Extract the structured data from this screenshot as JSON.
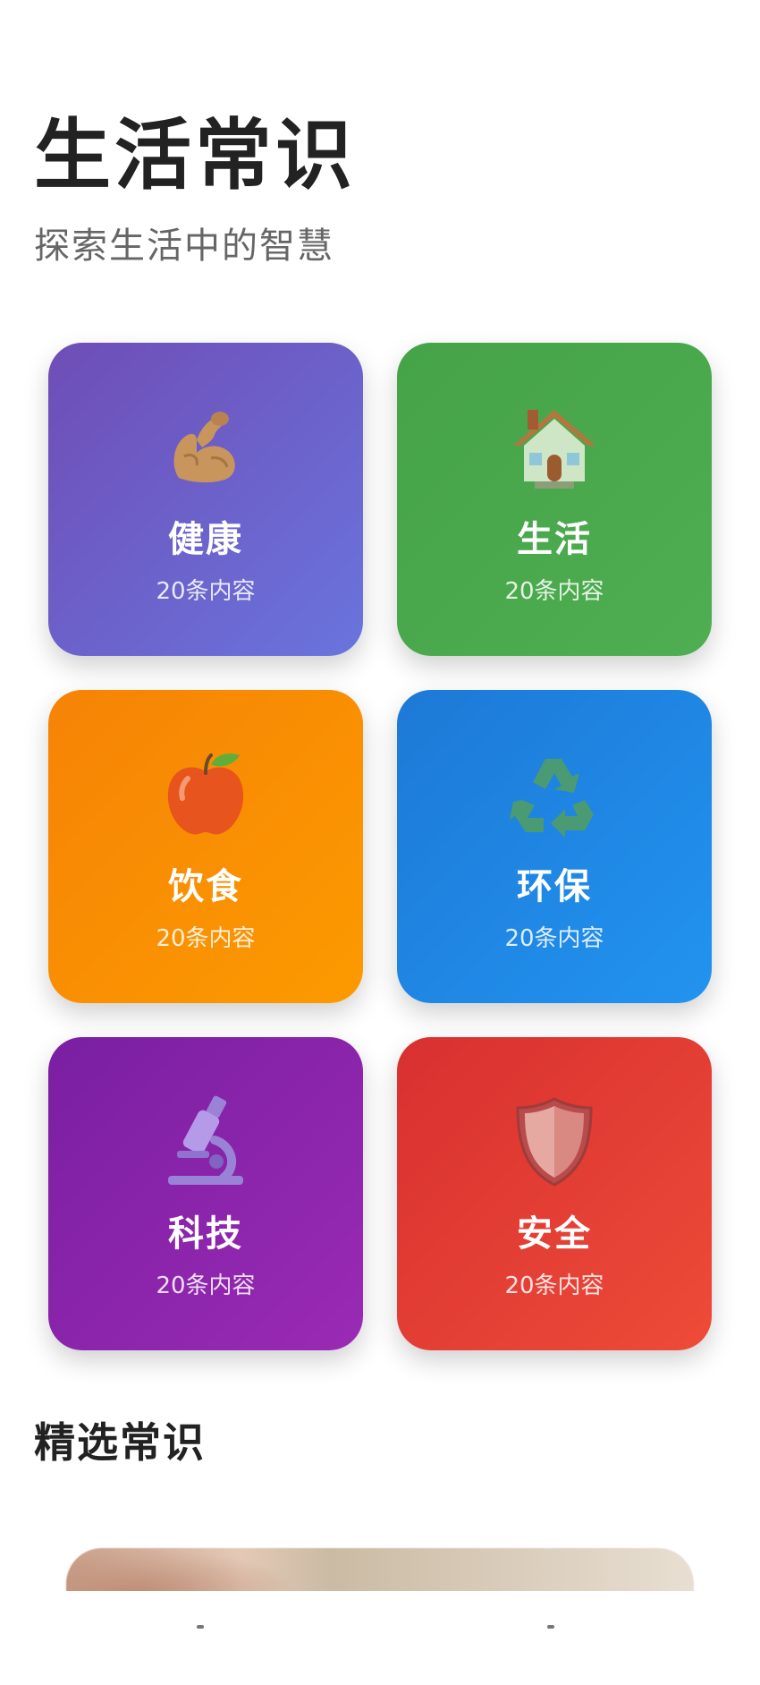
{
  "header": {
    "title": "生活常识",
    "subtitle": "探索生活中的智慧"
  },
  "categories": [
    {
      "label": "健康",
      "count": "20条内容",
      "icon": "flexed-biceps-icon",
      "colors": [
        "#6f4db6",
        "#6a74dd"
      ]
    },
    {
      "label": "生活",
      "count": "20条内容",
      "icon": "house-icon",
      "colors": [
        "#46a348",
        "#4fae51"
      ]
    },
    {
      "label": "饮食",
      "count": "20条内容",
      "icon": "apple-icon",
      "colors": [
        "#f68306",
        "#fc9a00"
      ]
    },
    {
      "label": "环保",
      "count": "20条内容",
      "icon": "recycle-icon",
      "colors": [
        "#1d79d6",
        "#2293f0"
      ]
    },
    {
      "label": "科技",
      "count": "20条内容",
      "icon": "microscope-icon",
      "colors": [
        "#7a1fa2",
        "#9a2ab4"
      ]
    },
    {
      "label": "安全",
      "count": "20条内容",
      "icon": "shield-icon",
      "colors": [
        "#d83030",
        "#ee4b38"
      ]
    }
  ],
  "featured": {
    "title": "精选常识"
  }
}
